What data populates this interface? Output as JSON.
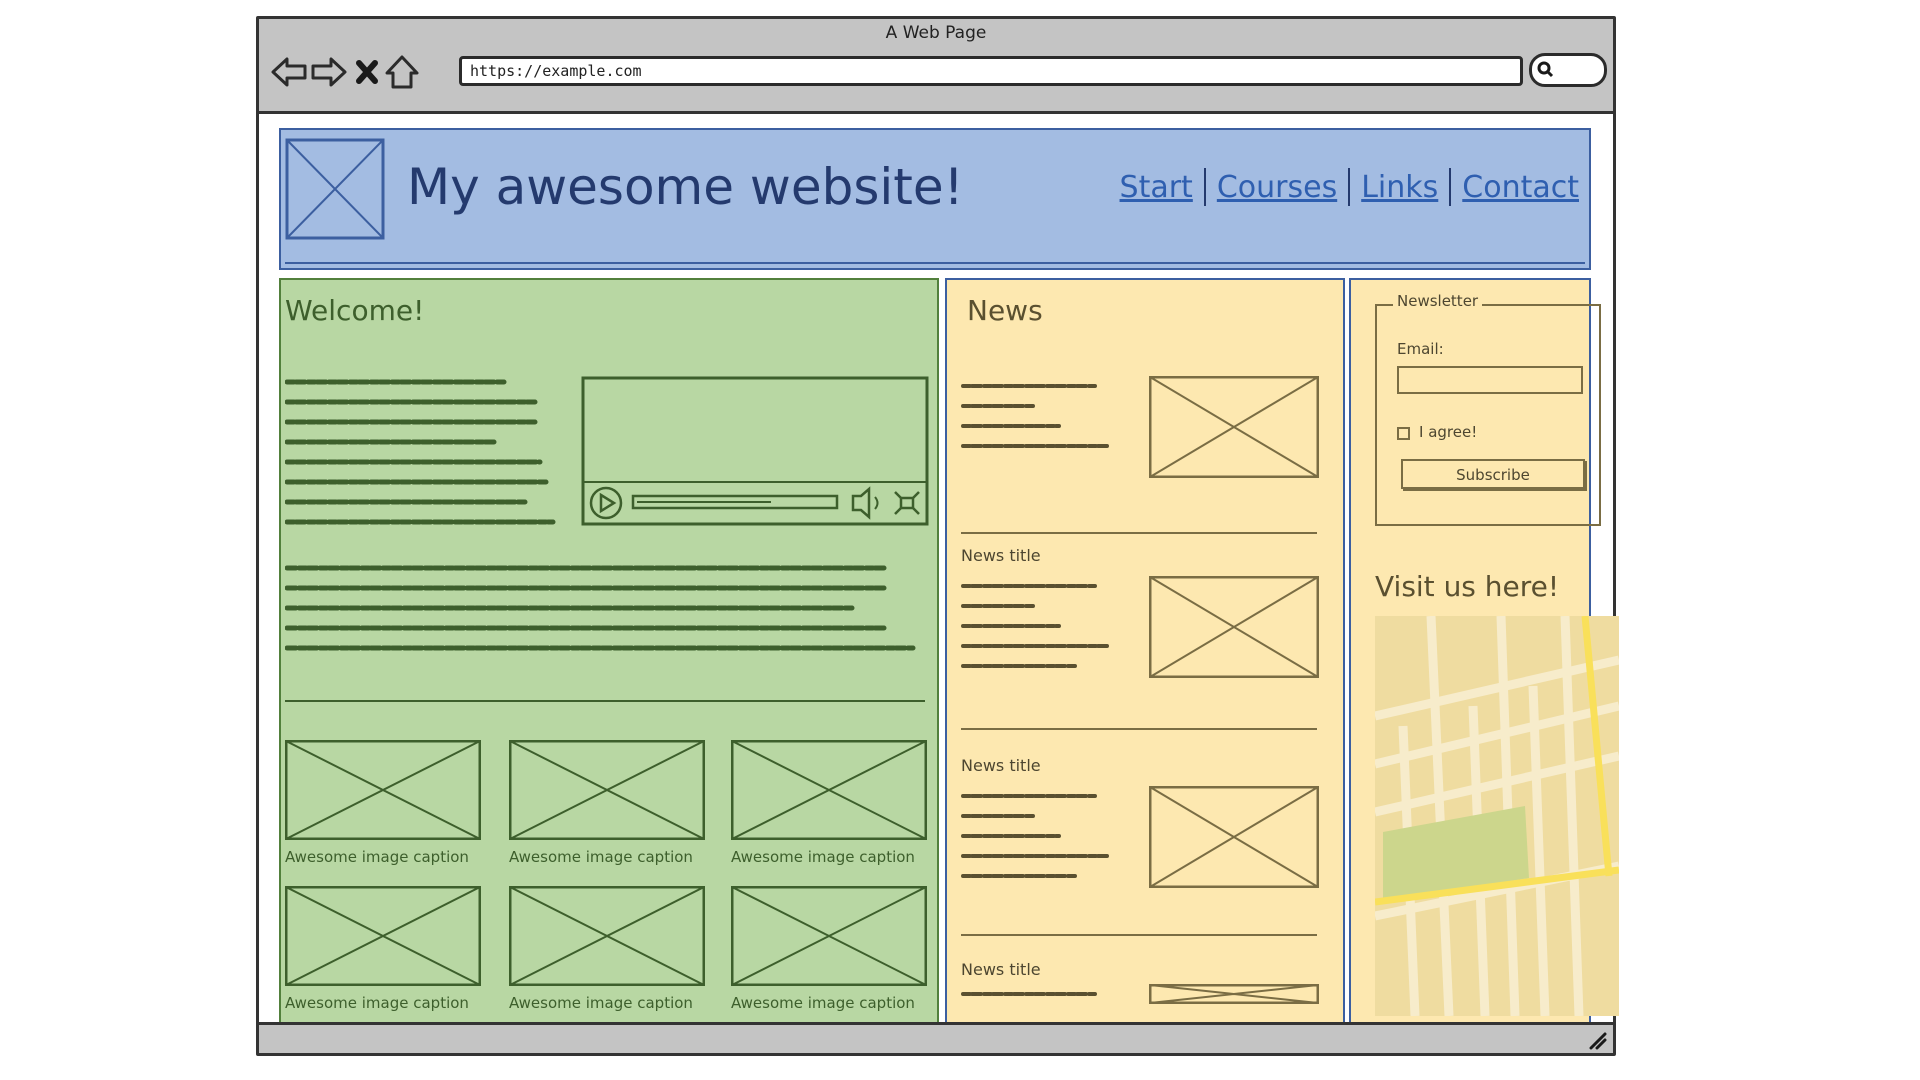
{
  "browser": {
    "window_title": "A Web Page",
    "url": "https://example.com"
  },
  "header": {
    "site_title": "My awesome website!",
    "nav": [
      "Start",
      "Courses",
      "Links",
      "Contact"
    ]
  },
  "welcome": {
    "heading": "Welcome!",
    "captions": [
      "Awesome image caption",
      "Awesome image caption",
      "Awesome image caption",
      "Awesome image caption",
      "Awesome image caption",
      "Awesome image caption"
    ]
  },
  "news": {
    "heading": "News",
    "items": [
      {
        "title": ""
      },
      {
        "title": "News title"
      },
      {
        "title": "News title"
      },
      {
        "title": "News title"
      }
    ]
  },
  "newsletter": {
    "legend": "Newsletter",
    "email_label": "Email:",
    "agree_label": "I agree!",
    "subscribe_label": "Subscribe"
  },
  "visit": {
    "heading": "Visit us here!"
  },
  "colors": {
    "header_bg": "#a3bce2",
    "welcome_bg": "#b8d7a3",
    "news_bg": "#fde8b0",
    "chrome": "#c4c4c4"
  }
}
